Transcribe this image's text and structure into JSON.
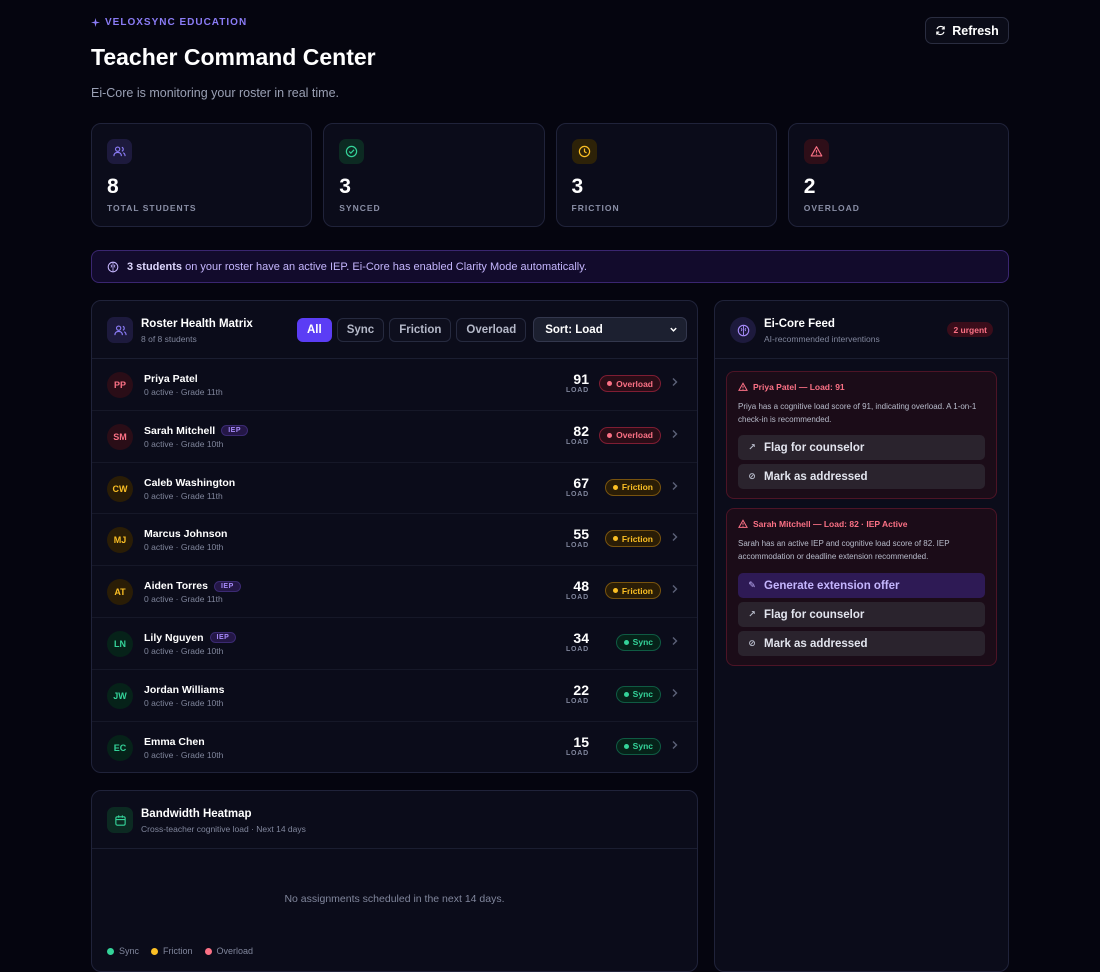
{
  "header": {
    "brand": "VELOXSYNC EDUCATION",
    "title": "Teacher Command Center",
    "subtitle": "Ei-Core is monitoring your roster in real time.",
    "refresh_label": "Refresh"
  },
  "stats": [
    {
      "value": "8",
      "label": "TOTAL STUDENTS",
      "icon": "users-icon",
      "color": "#8b7cf6"
    },
    {
      "value": "3",
      "label": "SYNCED",
      "icon": "check-circle-icon",
      "color": "#34d399"
    },
    {
      "value": "3",
      "label": "FRICTION",
      "icon": "clock-icon",
      "color": "#fbbf24"
    },
    {
      "value": "2",
      "label": "OVERLOAD",
      "icon": "alert-triangle-icon",
      "color": "#fb7185"
    }
  ],
  "iep_banner": {
    "count_text": "3 students",
    "rest_text": " on your roster have an active IEP. Ei-Core has enabled Clarity Mode automatically."
  },
  "roster": {
    "title": "Roster Health Matrix",
    "subtitle": "8 of 8 students",
    "filters": [
      "All",
      "Sync",
      "Friction",
      "Overload"
    ],
    "active_filter": "All",
    "sort_value": "Sort: Load",
    "load_label": "LOAD",
    "iep_label": "IEP",
    "students": [
      {
        "initials": "PP",
        "name": "Priya Patel",
        "iep": false,
        "meta": "0 active · Grade 11th",
        "load": "91",
        "status": "Overload"
      },
      {
        "initials": "SM",
        "name": "Sarah Mitchell",
        "iep": true,
        "meta": "0 active · Grade 10th",
        "load": "82",
        "status": "Overload"
      },
      {
        "initials": "CW",
        "name": "Caleb Washington",
        "iep": false,
        "meta": "0 active · Grade 11th",
        "load": "67",
        "status": "Friction"
      },
      {
        "initials": "MJ",
        "name": "Marcus Johnson",
        "iep": false,
        "meta": "0 active · Grade 10th",
        "load": "55",
        "status": "Friction"
      },
      {
        "initials": "AT",
        "name": "Aiden Torres",
        "iep": true,
        "meta": "0 active · Grade 11th",
        "load": "48",
        "status": "Friction"
      },
      {
        "initials": "LN",
        "name": "Lily Nguyen",
        "iep": true,
        "meta": "0 active · Grade 10th",
        "load": "34",
        "status": "Sync"
      },
      {
        "initials": "JW",
        "name": "Jordan Williams",
        "iep": false,
        "meta": "0 active · Grade 10th",
        "load": "22",
        "status": "Sync"
      },
      {
        "initials": "EC",
        "name": "Emma Chen",
        "iep": false,
        "meta": "0 active · Grade 10th",
        "load": "15",
        "status": "Sync"
      }
    ]
  },
  "heatmap": {
    "title": "Bandwidth Heatmap",
    "subtitle": "Cross-teacher cognitive load · Next 14 days",
    "empty_text": "No assignments scheduled in the next 14 days.",
    "legend": [
      {
        "label": "Sync",
        "color": "#34d399"
      },
      {
        "label": "Friction",
        "color": "#fbbf24"
      },
      {
        "label": "Overload",
        "color": "#fb7185"
      }
    ]
  },
  "feed": {
    "title": "Ei-Core Feed",
    "subtitle": "AI-recommended interventions",
    "urgent_badge": "2 urgent",
    "cards": [
      {
        "title": "Priya Patel — Load: 91",
        "text": "Priya has a cognitive load score of 91, indicating overload. A 1-on-1 check-in is recommended.",
        "actions": [
          {
            "label": "Flag for counselor",
            "icon": "trend-icon",
            "primary": false
          },
          {
            "label": "Mark as addressed",
            "icon": "check-circle-icon",
            "primary": false
          }
        ]
      },
      {
        "title": "Sarah Mitchell — Load: 82 · IEP Active",
        "text": "Sarah has an active IEP and cognitive load score of 82. IEP accommodation or deadline extension recommended.",
        "actions": [
          {
            "label": "Generate extension offer",
            "icon": "user-edit-icon",
            "primary": true
          },
          {
            "label": "Flag for counselor",
            "icon": "trend-icon",
            "primary": false
          },
          {
            "label": "Mark as addressed",
            "icon": "check-circle-icon",
            "primary": false
          }
        ]
      }
    ]
  }
}
